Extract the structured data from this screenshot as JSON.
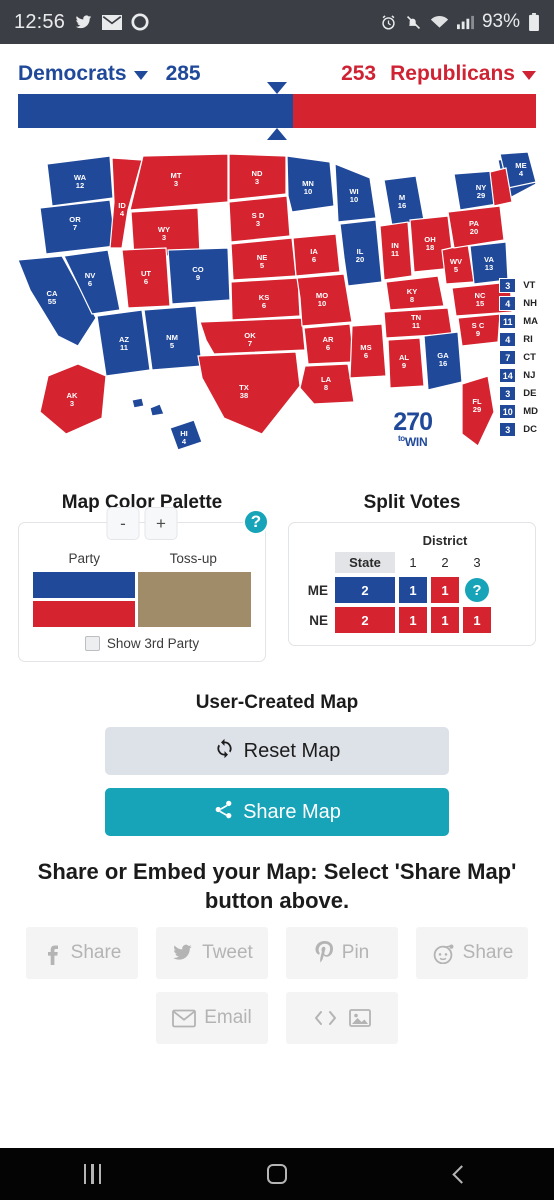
{
  "status_bar": {
    "time": "12:56",
    "left_icons": [
      "twitter-icon",
      "mail-icon",
      "circle-icon"
    ],
    "right_icons": [
      "alarm-icon",
      "bell-muted-icon",
      "wifi-icon",
      "signal-icon"
    ],
    "battery": "93%"
  },
  "tally": {
    "democrats_label": "Democrats",
    "democrats_votes": "285",
    "republicans_votes": "253",
    "republicans_label": "Republicans",
    "dem_color": "#20499a",
    "rep_color": "#d5232f",
    "dem_bar_percent": 53,
    "rep_bar_percent": 47
  },
  "map": {
    "logo_big": "270",
    "logo_small_pre": "to",
    "logo_small": "WIN",
    "states": [
      {
        "abbr": "WA",
        "votes": "12",
        "party": "D"
      },
      {
        "abbr": "OR",
        "votes": "7",
        "party": "D"
      },
      {
        "abbr": "CA",
        "votes": "55",
        "party": "D"
      },
      {
        "abbr": "NV",
        "votes": "6",
        "party": "D"
      },
      {
        "abbr": "ID",
        "votes": "4",
        "party": "R"
      },
      {
        "abbr": "MT",
        "votes": "3",
        "party": "R"
      },
      {
        "abbr": "WY",
        "votes": "3",
        "party": "R"
      },
      {
        "abbr": "UT",
        "votes": "6",
        "party": "R"
      },
      {
        "abbr": "AZ",
        "votes": "11",
        "party": "D"
      },
      {
        "abbr": "NM",
        "votes": "5",
        "party": "D"
      },
      {
        "abbr": "CO",
        "votes": "9",
        "party": "D"
      },
      {
        "abbr": "ND",
        "votes": "3",
        "party": "R"
      },
      {
        "abbr": "S D",
        "votes": "3",
        "party": "R"
      },
      {
        "abbr": "NE",
        "votes": "5",
        "party": "R"
      },
      {
        "abbr": "KS",
        "votes": "6",
        "party": "R"
      },
      {
        "abbr": "OK",
        "votes": "7",
        "party": "R"
      },
      {
        "abbr": "TX",
        "votes": "38",
        "party": "R"
      },
      {
        "abbr": "MN",
        "votes": "10",
        "party": "D"
      },
      {
        "abbr": "IA",
        "votes": "6",
        "party": "R"
      },
      {
        "abbr": "MO",
        "votes": "10",
        "party": "R"
      },
      {
        "abbr": "AR",
        "votes": "6",
        "party": "R"
      },
      {
        "abbr": "LA",
        "votes": "8",
        "party": "R"
      },
      {
        "abbr": "WI",
        "votes": "10",
        "party": "D"
      },
      {
        "abbr": "IL",
        "votes": "20",
        "party": "D"
      },
      {
        "abbr": "MS",
        "votes": "6",
        "party": "R"
      },
      {
        "abbr": "M",
        "votes": "16",
        "party": "D"
      },
      {
        "abbr": "IN",
        "votes": "11",
        "party": "R"
      },
      {
        "abbr": "KY",
        "votes": "8",
        "party": "R"
      },
      {
        "abbr": "TN",
        "votes": "11",
        "party": "R"
      },
      {
        "abbr": "AL",
        "votes": "9",
        "party": "R"
      },
      {
        "abbr": "OH",
        "votes": "18",
        "party": "R"
      },
      {
        "abbr": "WV",
        "votes": "5",
        "party": "R"
      },
      {
        "abbr": "GA",
        "votes": "16",
        "party": "D"
      },
      {
        "abbr": "PA",
        "votes": "20",
        "party": "R"
      },
      {
        "abbr": "VA",
        "votes": "13",
        "party": "D"
      },
      {
        "abbr": "NC",
        "votes": "15",
        "party": "R"
      },
      {
        "abbr": "S C",
        "votes": "9",
        "party": "R"
      },
      {
        "abbr": "FL",
        "votes": "29",
        "party": "R"
      },
      {
        "abbr": "NY",
        "votes": "29",
        "party": "D"
      },
      {
        "abbr": "ME",
        "votes": "4",
        "party": "D"
      },
      {
        "abbr": "AK",
        "votes": "3",
        "party": "R"
      },
      {
        "abbr": "HI",
        "votes": "4",
        "party": "D"
      }
    ],
    "side_list": [
      {
        "votes": "3",
        "abbr": "VT",
        "party": "D"
      },
      {
        "votes": "4",
        "abbr": "NH",
        "party": "D"
      },
      {
        "votes": "11",
        "abbr": "MA",
        "party": "D"
      },
      {
        "votes": "4",
        "abbr": "RI",
        "party": "D"
      },
      {
        "votes": "7",
        "abbr": "CT",
        "party": "D"
      },
      {
        "votes": "14",
        "abbr": "NJ",
        "party": "D"
      },
      {
        "votes": "3",
        "abbr": "DE",
        "party": "D"
      },
      {
        "votes": "10",
        "abbr": "MD",
        "party": "D"
      },
      {
        "votes": "3",
        "abbr": "DC",
        "party": "D"
      }
    ]
  },
  "palette": {
    "title": "Map Color Palette",
    "minus_label": "-",
    "plus_label": "+",
    "help_label": "?",
    "party_header": "Party",
    "tossup_header": "Toss-up",
    "dem_color": "#20499a",
    "rep_color": "#d5232f",
    "tossup_color": "#a08c68",
    "third_party_label": "Show 3rd Party",
    "third_party_checked": false
  },
  "split_votes": {
    "title": "Split Votes",
    "state_header": "State",
    "district_header": "District",
    "district_numbers": [
      "1",
      "2",
      "3"
    ],
    "help_label": "?",
    "rows": [
      {
        "label": "ME",
        "state": {
          "value": "2",
          "party": "D"
        },
        "districts": [
          {
            "value": "1",
            "party": "D"
          },
          {
            "value": "1",
            "party": "R"
          },
          {
            "value": "?",
            "party": "help"
          }
        ]
      },
      {
        "label": "NE",
        "state": {
          "value": "2",
          "party": "R"
        },
        "districts": [
          {
            "value": "1",
            "party": "R"
          },
          {
            "value": "1",
            "party": "R"
          },
          {
            "value": "1",
            "party": "R"
          }
        ]
      }
    ]
  },
  "user_map": {
    "title": "User-Created Map",
    "reset_label": "Reset Map",
    "reset_icon": "refresh-icon",
    "share_label": "Share Map",
    "share_icon": "share-nodes-icon",
    "share_color": "#17a3b8"
  },
  "share": {
    "heading": "Share or Embed your Map: Select 'Share Map' button above.",
    "buttons": [
      {
        "icon": "facebook-icon",
        "label": "Share"
      },
      {
        "icon": "twitter-icon",
        "label": "Tweet"
      },
      {
        "icon": "pinterest-icon",
        "label": "Pin"
      },
      {
        "icon": "reddit-icon",
        "label": "Share"
      }
    ],
    "buttons_row2": [
      {
        "icon": "email-icon",
        "label": "Email"
      },
      {
        "icon": "embed-code-icon",
        "label": ""
      }
    ]
  },
  "navbar": {
    "recents": "recents-icon",
    "home": "home-icon",
    "back": "back-icon"
  }
}
